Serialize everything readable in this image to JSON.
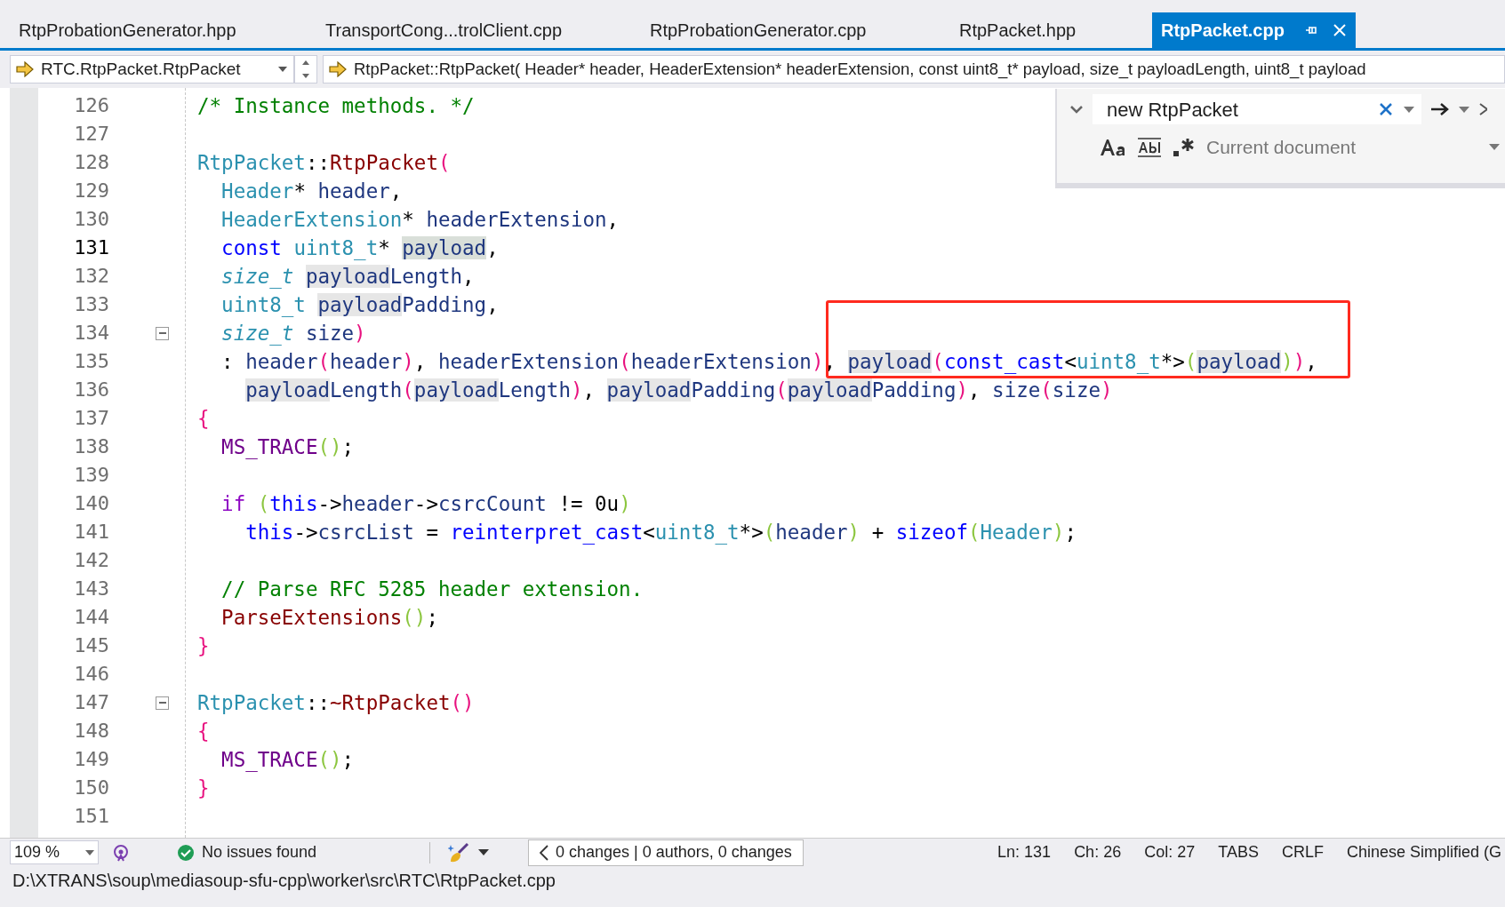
{
  "tabs": [
    {
      "label": "RtpProbationGenerator.hpp",
      "selected": false
    },
    {
      "label": "TransportCong...trolClient.cpp",
      "selected": false
    },
    {
      "label": "RtpProbationGenerator.cpp",
      "selected": false
    },
    {
      "label": "RtpPacket.hpp",
      "selected": false
    },
    {
      "label": "RtpPacket.cpp",
      "selected": true
    }
  ],
  "nav": {
    "scope": "RTC.RtpPacket.RtpPacket",
    "member": "RtpPacket::RtpPacket( Header* header, HeaderExtension* headerExtension, const uint8_t* payload, size_t payloadLength, uint8_t payload"
  },
  "find": {
    "value": "new RtpPacket",
    "scope": "Current document"
  },
  "editor": {
    "lines": [
      {
        "number": "126",
        "current": false,
        "fold": false,
        "tokens": [
          {
            "text": "/* Instance methods. */",
            "kind": "comment",
            "highlighted": false
          }
        ]
      },
      {
        "number": "127",
        "current": false,
        "fold": false
      },
      {
        "number": "128",
        "current": false,
        "fold": false,
        "tokens": [
          {
            "text": "RtpPacket",
            "kind": "type",
            "highlighted": false
          },
          {
            "text": "::",
            "kind": "plain",
            "highlighted": false
          },
          {
            "text": "RtpPacket",
            "kind": "func",
            "highlighted": false
          },
          {
            "text": "(",
            "kind": "p1",
            "highlighted": false
          }
        ]
      },
      {
        "number": "129",
        "current": false,
        "fold": false,
        "tokens": [
          {
            "text": "  Header",
            "kind": "type",
            "highlighted": false
          },
          {
            "text": "* ",
            "kind": "plain",
            "highlighted": false
          },
          {
            "text": "header",
            "kind": "param",
            "highlighted": false
          },
          {
            "text": ",",
            "kind": "plain",
            "highlighted": false
          }
        ]
      },
      {
        "number": "130",
        "current": false,
        "fold": false,
        "tokens": [
          {
            "text": "  HeaderExtension",
            "kind": "type",
            "highlighted": false
          },
          {
            "text": "* ",
            "kind": "plain",
            "highlighted": false
          },
          {
            "text": "headerExtension",
            "kind": "param",
            "highlighted": false
          },
          {
            "text": ",",
            "kind": "plain",
            "highlighted": false
          }
        ]
      },
      {
        "number": "131",
        "current": true,
        "fold": false,
        "tokens": [
          {
            "text": "  const",
            "kind": "keyword",
            "highlighted": false
          },
          {
            "text": " uint8_t",
            "kind": "type",
            "highlighted": false
          },
          {
            "text": "* ",
            "kind": "plain",
            "highlighted": false
          },
          {
            "text": "payload",
            "kind": "param",
            "highlighted": true
          },
          {
            "text": ",",
            "kind": "plain",
            "highlighted": false
          }
        ]
      },
      {
        "number": "132",
        "current": false,
        "fold": false,
        "tokens": [
          {
            "text": "  size_t",
            "kind": "typedef",
            "highlighted": false
          },
          {
            "text": " payload",
            "kind": "param",
            "highlighted": true
          },
          {
            "text": "Length",
            "kind": "param",
            "highlighted": false
          },
          {
            "text": ",",
            "kind": "plain",
            "highlighted": false
          }
        ]
      },
      {
        "number": "133",
        "current": false,
        "fold": false,
        "tokens": [
          {
            "text": "  uint8_t",
            "kind": "type",
            "highlighted": false
          },
          {
            "text": " payload",
            "kind": "param",
            "highlighted": true
          },
          {
            "text": "Padding",
            "kind": "param",
            "highlighted": false
          },
          {
            "text": ",",
            "kind": "plain",
            "highlighted": false
          }
        ]
      },
      {
        "number": "134",
        "current": false,
        "fold": true,
        "tokens": [
          {
            "text": "  size_t",
            "kind": "typedef",
            "highlighted": false
          },
          {
            "text": " size",
            "kind": "param",
            "highlighted": false
          },
          {
            "text": ")",
            "kind": "p1",
            "highlighted": false
          }
        ]
      },
      {
        "number": "135",
        "current": false,
        "fold": false,
        "tokens": [
          {
            "text": "  :",
            "kind": "plain",
            "highlighted": false
          },
          {
            "text": " header",
            "kind": "member",
            "highlighted": false
          },
          {
            "text": "(",
            "kind": "p1",
            "highlighted": false
          },
          {
            "text": "header",
            "kind": "param",
            "highlighted": false
          },
          {
            "text": ")",
            "kind": "p1",
            "highlighted": false
          },
          {
            "text": ",",
            "kind": "plain",
            "highlighted": false
          },
          {
            "text": " headerExtension",
            "kind": "member",
            "highlighted": false
          },
          {
            "text": "(",
            "kind": "p1",
            "highlighted": false
          },
          {
            "text": "headerExtension",
            "kind": "param",
            "highlighted": false
          },
          {
            "text": ")",
            "kind": "p1",
            "highlighted": false
          },
          {
            "text": ",",
            "kind": "plain",
            "highlighted": false
          },
          {
            "text": " payload",
            "kind": "member",
            "highlighted": true
          },
          {
            "text": "(",
            "kind": "p1",
            "highlighted": false
          },
          {
            "text": "const_cast",
            "kind": "keyword",
            "highlighted": false
          },
          {
            "text": "<",
            "kind": "plain",
            "highlighted": false
          },
          {
            "text": "uint8_t",
            "kind": "type",
            "highlighted": false
          },
          {
            "text": "*>",
            "kind": "plain",
            "highlighted": false
          },
          {
            "text": "(",
            "kind": "p2",
            "highlighted": false
          },
          {
            "text": "payload",
            "kind": "param",
            "highlighted": true
          },
          {
            "text": ")",
            "kind": "p2",
            "highlighted": false
          },
          {
            "text": ")",
            "kind": "p1",
            "highlighted": false
          },
          {
            "text": ",",
            "kind": "plain",
            "highlighted": false
          }
        ]
      },
      {
        "number": "136",
        "current": false,
        "fold": false,
        "tokens": [
          {
            "text": "    payload",
            "kind": "member",
            "highlighted": true
          },
          {
            "text": "Length",
            "kind": "member",
            "highlighted": false
          },
          {
            "text": "(",
            "kind": "p1",
            "highlighted": false
          },
          {
            "text": "payload",
            "kind": "param",
            "highlighted": true
          },
          {
            "text": "Length",
            "kind": "param",
            "highlighted": false
          },
          {
            "text": ")",
            "kind": "p1",
            "highlighted": false
          },
          {
            "text": ",",
            "kind": "plain",
            "highlighted": false
          },
          {
            "text": " payload",
            "kind": "member",
            "highlighted": true
          },
          {
            "text": "Padding",
            "kind": "member",
            "highlighted": false
          },
          {
            "text": "(",
            "kind": "p1",
            "highlighted": false
          },
          {
            "text": "payload",
            "kind": "param",
            "highlighted": true
          },
          {
            "text": "Padding",
            "kind": "param",
            "highlighted": false
          },
          {
            "text": ")",
            "kind": "p1",
            "highlighted": false
          },
          {
            "text": ",",
            "kind": "plain",
            "highlighted": false
          },
          {
            "text": " size",
            "kind": "member",
            "highlighted": false
          },
          {
            "text": "(",
            "kind": "p1",
            "highlighted": false
          },
          {
            "text": "size",
            "kind": "param",
            "highlighted": false
          },
          {
            "text": ")",
            "kind": "p1",
            "highlighted": false
          }
        ]
      },
      {
        "number": "137",
        "current": false,
        "fold": false,
        "tokens": [
          {
            "text": "{",
            "kind": "p1",
            "highlighted": false
          }
        ]
      },
      {
        "number": "138",
        "current": false,
        "fold": false,
        "tokens": [
          {
            "text": "  MS_TRACE",
            "kind": "macro",
            "highlighted": false
          },
          {
            "text": "()",
            "kind": "p2",
            "highlighted": false
          },
          {
            "text": ";",
            "kind": "plain",
            "highlighted": false
          }
        ]
      },
      {
        "number": "139",
        "current": false,
        "fold": false
      },
      {
        "number": "140",
        "current": false,
        "fold": false,
        "tokens": [
          {
            "text": "  if",
            "kind": "ctrl",
            "highlighted": false
          },
          {
            "text": " (",
            "kind": "p2",
            "highlighted": false
          },
          {
            "text": "this",
            "kind": "keyword",
            "highlighted": false
          },
          {
            "text": "->",
            "kind": "plain",
            "highlighted": false
          },
          {
            "text": "header",
            "kind": "member",
            "highlighted": false
          },
          {
            "text": "->",
            "kind": "plain",
            "highlighted": false
          },
          {
            "text": "csrcCount",
            "kind": "member",
            "highlighted": false
          },
          {
            "text": " != 0u",
            "kind": "plain",
            "highlighted": false
          },
          {
            "text": ")",
            "kind": "p2",
            "highlighted": false
          }
        ]
      },
      {
        "number": "141",
        "current": false,
        "fold": false,
        "tokens": [
          {
            "text": "    this",
            "kind": "keyword",
            "highlighted": false
          },
          {
            "text": "->",
            "kind": "plain",
            "highlighted": false
          },
          {
            "text": "csrcList",
            "kind": "member",
            "highlighted": false
          },
          {
            "text": " =",
            "kind": "plain",
            "highlighted": false
          },
          {
            "text": " reinterpret_cast",
            "kind": "keyword",
            "highlighted": false
          },
          {
            "text": "<",
            "kind": "plain",
            "highlighted": false
          },
          {
            "text": "uint8_t",
            "kind": "type",
            "highlighted": false
          },
          {
            "text": "*>",
            "kind": "plain",
            "highlighted": false
          },
          {
            "text": "(",
            "kind": "p2",
            "highlighted": false
          },
          {
            "text": "header",
            "kind": "param",
            "highlighted": false
          },
          {
            "text": ")",
            "kind": "p2",
            "highlighted": false
          },
          {
            "text": " +",
            "kind": "plain",
            "highlighted": false
          },
          {
            "text": " sizeof",
            "kind": "keyword",
            "highlighted": false
          },
          {
            "text": "(",
            "kind": "p2",
            "highlighted": false
          },
          {
            "text": "Header",
            "kind": "type",
            "highlighted": false
          },
          {
            "text": ")",
            "kind": "p2",
            "highlighted": false
          },
          {
            "text": ";",
            "kind": "plain",
            "highlighted": false
          }
        ]
      },
      {
        "number": "142",
        "current": false,
        "fold": false
      },
      {
        "number": "143",
        "current": false,
        "fold": false,
        "tokens": [
          {
            "text": "  // Parse RFC 5285 header extension.",
            "kind": "comment",
            "highlighted": false
          }
        ]
      },
      {
        "number": "144",
        "current": false,
        "fold": false,
        "tokens": [
          {
            "text": "  ParseExtensions",
            "kind": "func",
            "highlighted": false
          },
          {
            "text": "()",
            "kind": "p2",
            "highlighted": false
          },
          {
            "text": ";",
            "kind": "plain",
            "highlighted": false
          }
        ]
      },
      {
        "number": "145",
        "current": false,
        "fold": false,
        "tokens": [
          {
            "text": "}",
            "kind": "p1",
            "highlighted": false
          }
        ]
      },
      {
        "number": "146",
        "current": false,
        "fold": false
      },
      {
        "number": "147",
        "current": false,
        "fold": true,
        "tokens": [
          {
            "text": "RtpPacket",
            "kind": "type",
            "highlighted": false
          },
          {
            "text": "::",
            "kind": "plain",
            "highlighted": false
          },
          {
            "text": "~RtpPacket",
            "kind": "func",
            "highlighted": false
          },
          {
            "text": "()",
            "kind": "p1",
            "highlighted": false
          }
        ]
      },
      {
        "number": "148",
        "current": false,
        "fold": false,
        "tokens": [
          {
            "text": "{",
            "kind": "p1",
            "highlighted": false
          }
        ]
      },
      {
        "number": "149",
        "current": false,
        "fold": false,
        "tokens": [
          {
            "text": "  MS_TRACE",
            "kind": "macro",
            "highlighted": false
          },
          {
            "text": "()",
            "kind": "p2",
            "highlighted": false
          },
          {
            "text": ";",
            "kind": "plain",
            "highlighted": false
          }
        ]
      },
      {
        "number": "150",
        "current": false,
        "fold": false,
        "tokens": [
          {
            "text": "}",
            "kind": "p1",
            "highlighted": false
          }
        ]
      },
      {
        "number": "151",
        "current": false,
        "fold": false
      }
    ],
    "annotations": [
      {
        "kind": "rectangle"
      }
    ]
  },
  "status_bar": {
    "zoom": "109 %",
    "issues": "No issues found",
    "changes": "0 changes | 0 authors, 0 changes",
    "items": [
      "Ln: 131",
      "Ch: 26",
      "Col: 27",
      "TABS",
      "CRLF",
      "Chinese Simplified (G"
    ]
  },
  "path": "D:\\XTRANS\\soup\\mediasoup-sfu-cpp\\worker\\src\\RTC\\RtpPacket.cpp"
}
